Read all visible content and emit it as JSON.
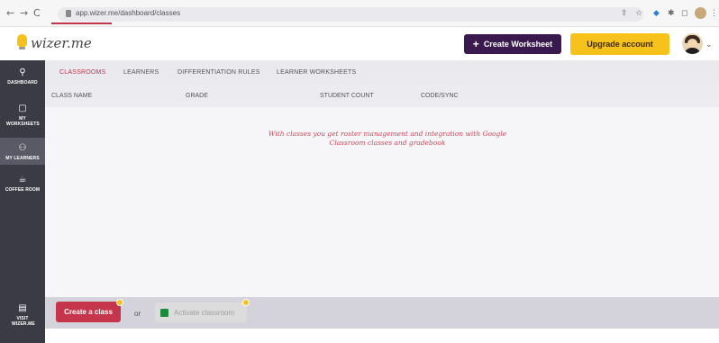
{
  "browser": {
    "back": "←",
    "forward": "→",
    "reload": "C",
    "url": "app.wizer.me/dashboard/classes"
  },
  "app": {
    "logo_text": "wizer.me",
    "create_worksheet_label": "Create Worksheet",
    "create_worksheet_plus": "+",
    "upgrade_label": "Upgrade account",
    "avatar_chevron": "⌄"
  },
  "sidebar": {
    "items": [
      {
        "icon": "search-icon",
        "glyph": "⚲",
        "label": "DASHBOARD"
      },
      {
        "icon": "worksheet-icon",
        "glyph": "▢",
        "label": "MY WORKSHEETS"
      },
      {
        "icon": "learners-icon",
        "glyph": "⚇",
        "label": "MY LEARNERS"
      },
      {
        "icon": "coffee-icon",
        "glyph": "☕",
        "label": "COFFEE ROOM"
      },
      {
        "icon": "visit-icon",
        "glyph": "▤",
        "label": "VISIT WIZER.ME"
      }
    ],
    "active_index": 2
  },
  "tabs": [
    {
      "label": "CLASSROOMS",
      "active": true
    },
    {
      "label": "LEARNERS",
      "active": false
    },
    {
      "label": "DIFFERENTIATION RULES",
      "active": false
    },
    {
      "label": "LEARNER WORKSHEETS",
      "active": false
    }
  ],
  "table": {
    "columns": [
      "CLASS NAME",
      "GRADE",
      "STUDENT COUNT",
      "CODE/SYNC"
    ],
    "empty_message_line1": "With classes you get roster management and integration with Google",
    "empty_message_line2": "Classroom classes and gradebook"
  },
  "footer": {
    "create_class_label": "Create a class",
    "or_label": "or",
    "activate_label": "Activate classroom"
  },
  "colors": {
    "accent": "#c5354b",
    "brand_dark": "#3a1a4e",
    "upgrade": "#f7c21c",
    "sidebar": "#3b3b45"
  }
}
